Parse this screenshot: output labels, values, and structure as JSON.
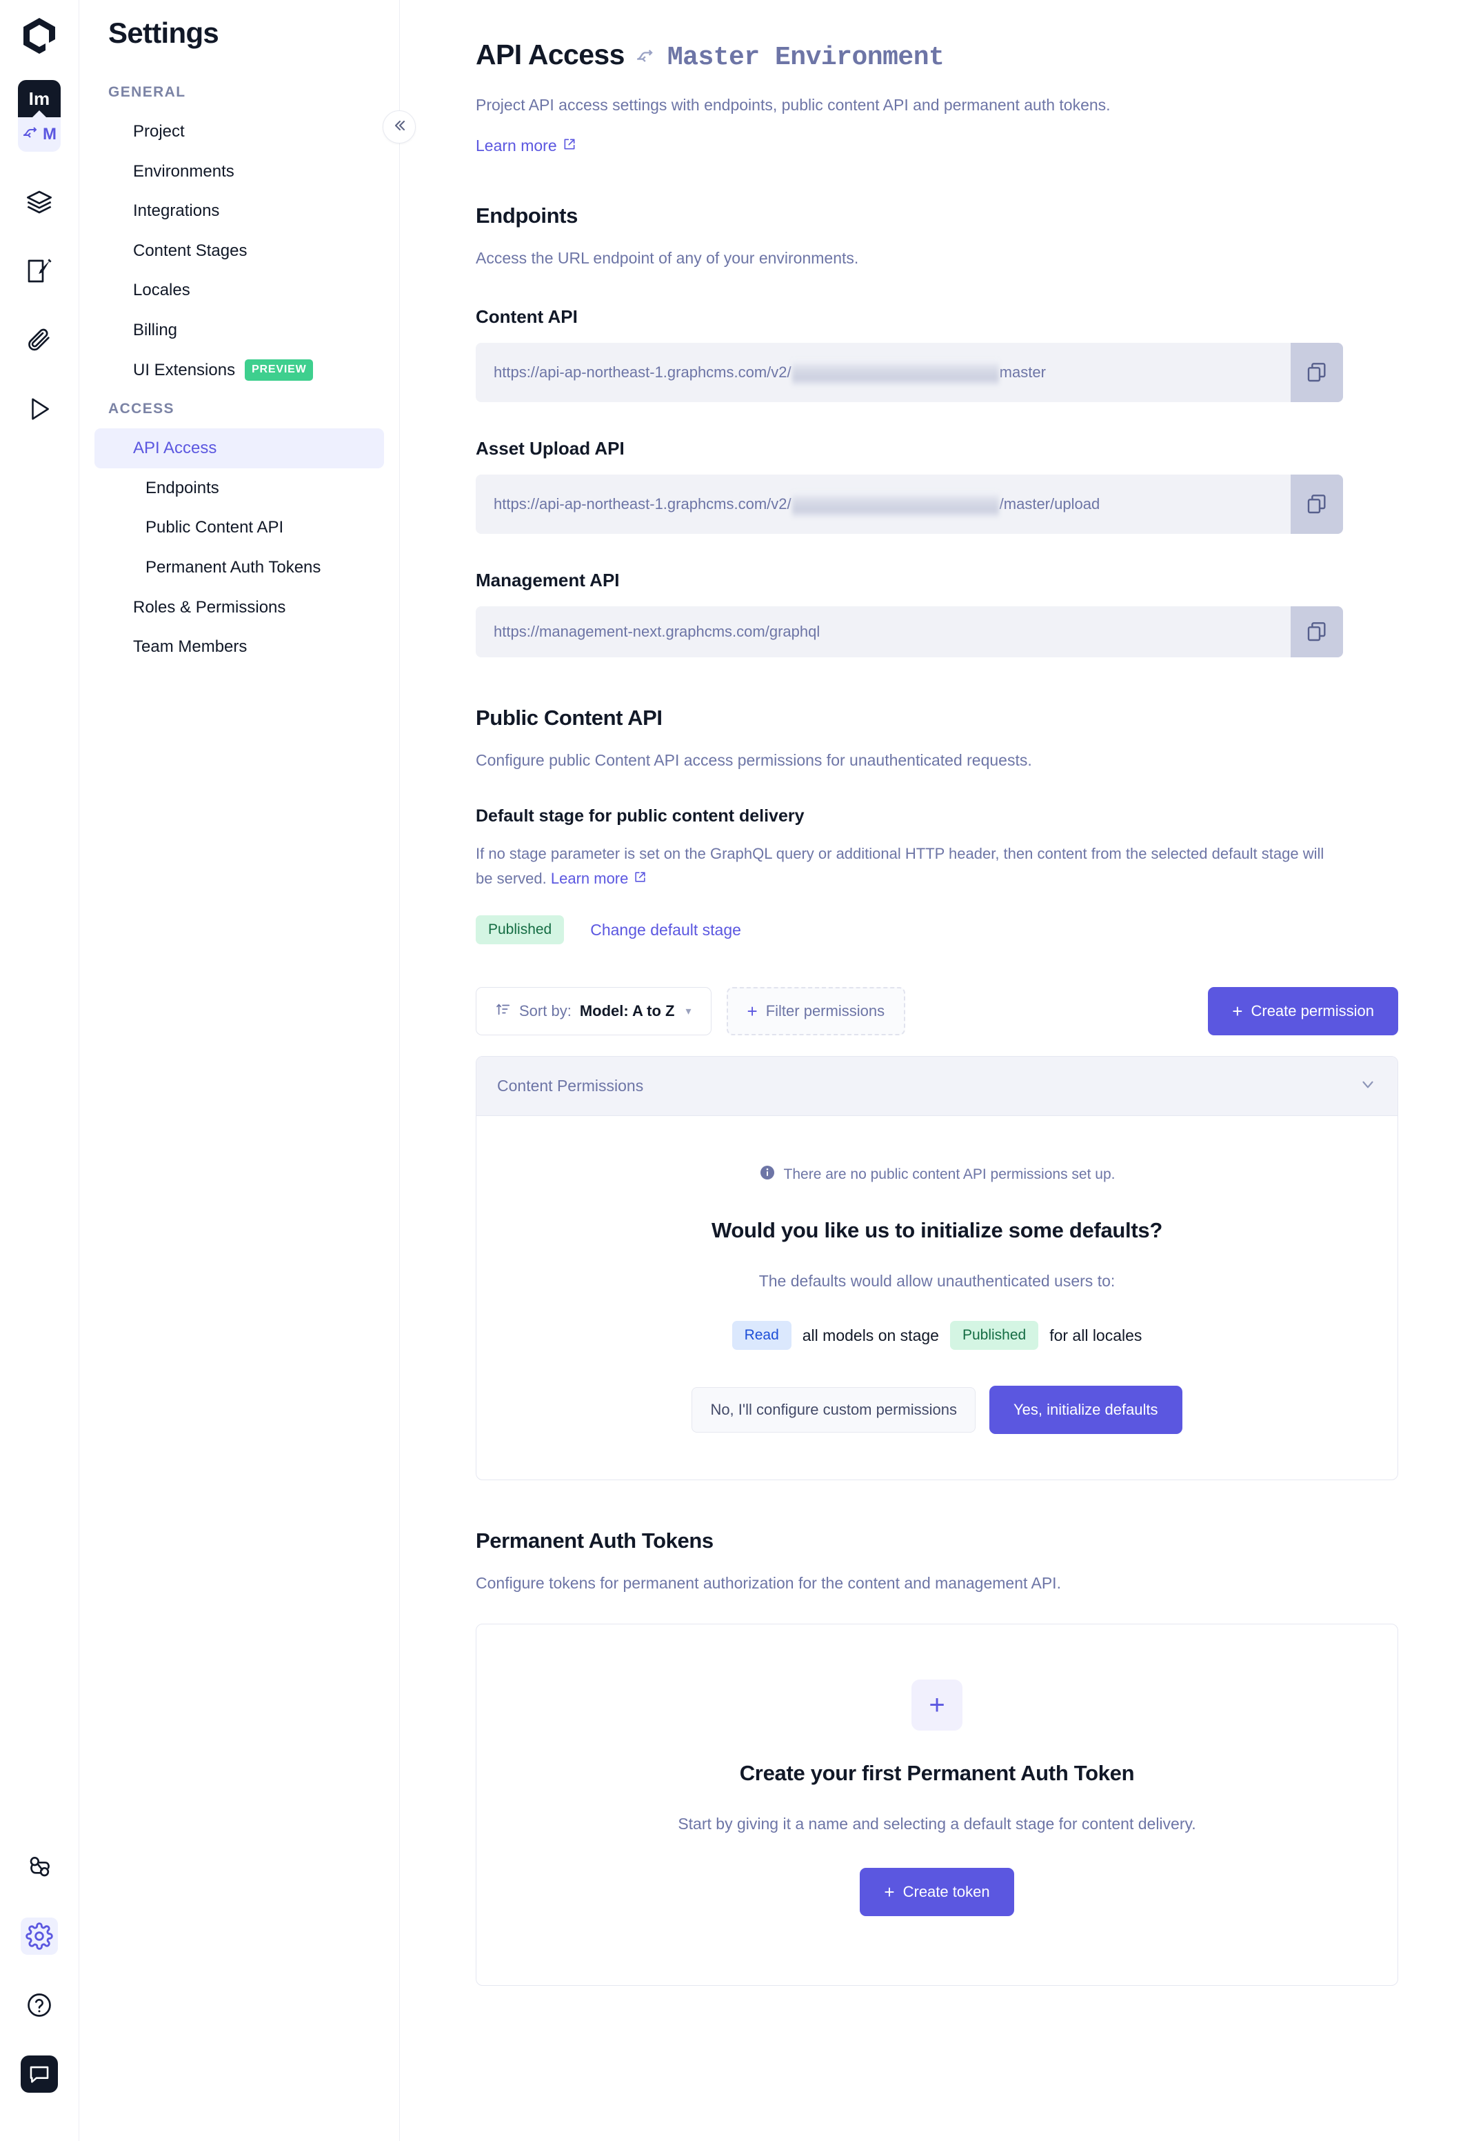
{
  "rail": {
    "logo_icon": "graphcms-logo-icon",
    "project_badge": {
      "initials": "Im",
      "environment": "M",
      "env_icon": "environment-branch-icon"
    },
    "icons": [
      {
        "name": "schema-layers-icon",
        "label": "Schema"
      },
      {
        "name": "content-edit-icon",
        "label": "Content"
      },
      {
        "name": "assets-paperclip-icon",
        "label": "Assets"
      },
      {
        "name": "api-playground-play-icon",
        "label": "API Playground"
      }
    ],
    "bottom_icons": [
      {
        "name": "webhooks-icon",
        "label": "Webhooks"
      },
      {
        "name": "settings-gear-icon",
        "label": "Settings",
        "active": true
      },
      {
        "name": "help-question-icon",
        "label": "Help"
      },
      {
        "name": "chat-support-icon",
        "label": "Support chat"
      }
    ]
  },
  "sidebar": {
    "title": "Settings",
    "collapse_icon": "chevron-double-left-icon",
    "groups": [
      {
        "label": "GENERAL",
        "items": [
          {
            "label": "Project"
          },
          {
            "label": "Environments"
          },
          {
            "label": "Integrations"
          },
          {
            "label": "Content Stages"
          },
          {
            "label": "Locales"
          },
          {
            "label": "Billing"
          },
          {
            "label": "UI Extensions",
            "badge": "PREVIEW"
          }
        ]
      },
      {
        "label": "ACCESS",
        "items": [
          {
            "label": "API Access",
            "active": true
          },
          {
            "label": "Endpoints",
            "sub": true
          },
          {
            "label": "Public Content API",
            "sub": true
          },
          {
            "label": "Permanent Auth Tokens",
            "sub": true
          },
          {
            "label": "Roles & Permissions"
          },
          {
            "label": "Team Members"
          }
        ]
      }
    ]
  },
  "main": {
    "title": "API Access",
    "environment": "Master Environment",
    "environment_icon": "environment-branch-icon",
    "description": "Project API access settings with endpoints, public content API and permanent auth tokens.",
    "learn_more": "Learn more",
    "external_link_icon": "external-link-icon",
    "endpoints": {
      "heading": "Endpoints",
      "description": "Access the URL endpoint of any of your environments.",
      "copy_icon": "copy-icon",
      "fields": [
        {
          "label": "Content API",
          "prefix": "https://api-ap-northeast-1.graphcms.com/v2/",
          "redacted": true,
          "suffix": "master"
        },
        {
          "label": "Asset Upload API",
          "prefix": "https://api-ap-northeast-1.graphcms.com/v2/",
          "redacted": true,
          "suffix": "/master/upload"
        },
        {
          "label": "Management API",
          "prefix": "https://management-next.graphcms.com/graphql",
          "redacted": false,
          "suffix": ""
        }
      ]
    },
    "public_content_api": {
      "heading": "Public Content API",
      "description": "Configure public Content API access permissions for unauthenticated requests.",
      "default_stage_label": "Default stage for public content delivery",
      "default_stage_helper": "If no stage parameter is set on the GraphQL query or additional HTTP header, then content from the selected default stage will be served.",
      "default_stage_helper_link": "Learn more",
      "current_stage": "Published",
      "change_stage_link": "Change default stage",
      "toolbar": {
        "sort_icon": "sort-ascending-icon",
        "sort_prefix": "Sort by:",
        "sort_value": "Model: A to Z",
        "sort_chevron_icon": "chevron-down-icon",
        "filter_label": "Filter permissions",
        "filter_plus_icon": "plus-icon",
        "create_label": "Create permission",
        "create_plus_icon": "plus-icon"
      },
      "panel": {
        "title": "Content Permissions",
        "collapse_icon": "chevron-down-icon",
        "info_icon": "info-circle-icon",
        "empty_note": "There are no public content API permissions set up.",
        "empty_heading": "Would you like us to initialize some defaults?",
        "empty_sub": "The defaults would allow unauthenticated users to:",
        "perm_action": "Read",
        "perm_mid": "all models on stage",
        "perm_stage": "Published",
        "perm_tail": "for all locales",
        "decline_label": "No, I'll configure custom permissions",
        "accept_label": "Yes, initialize defaults"
      }
    },
    "permanent_auth_tokens": {
      "heading": "Permanent Auth Tokens",
      "description": "Configure tokens for permanent authorization for the content and management API.",
      "plus_icon": "plus-icon",
      "empty_title": "Create your first Permanent Auth Token",
      "empty_sub": "Start by giving it a name and selecting a default stage for content delivery.",
      "create_label": "Create token",
      "create_plus_icon": "plus-icon"
    }
  },
  "colors": {
    "accent": "#5b57e0",
    "accent_soft": "#eef0fe",
    "green": "#3ecf8e",
    "green_soft": "#d4f5e3",
    "green_text": "#146c43",
    "blue_soft": "#dbe8fd",
    "blue_text": "#1d4ed8",
    "muted_text": "#6d75a6",
    "dark": "#111827"
  }
}
